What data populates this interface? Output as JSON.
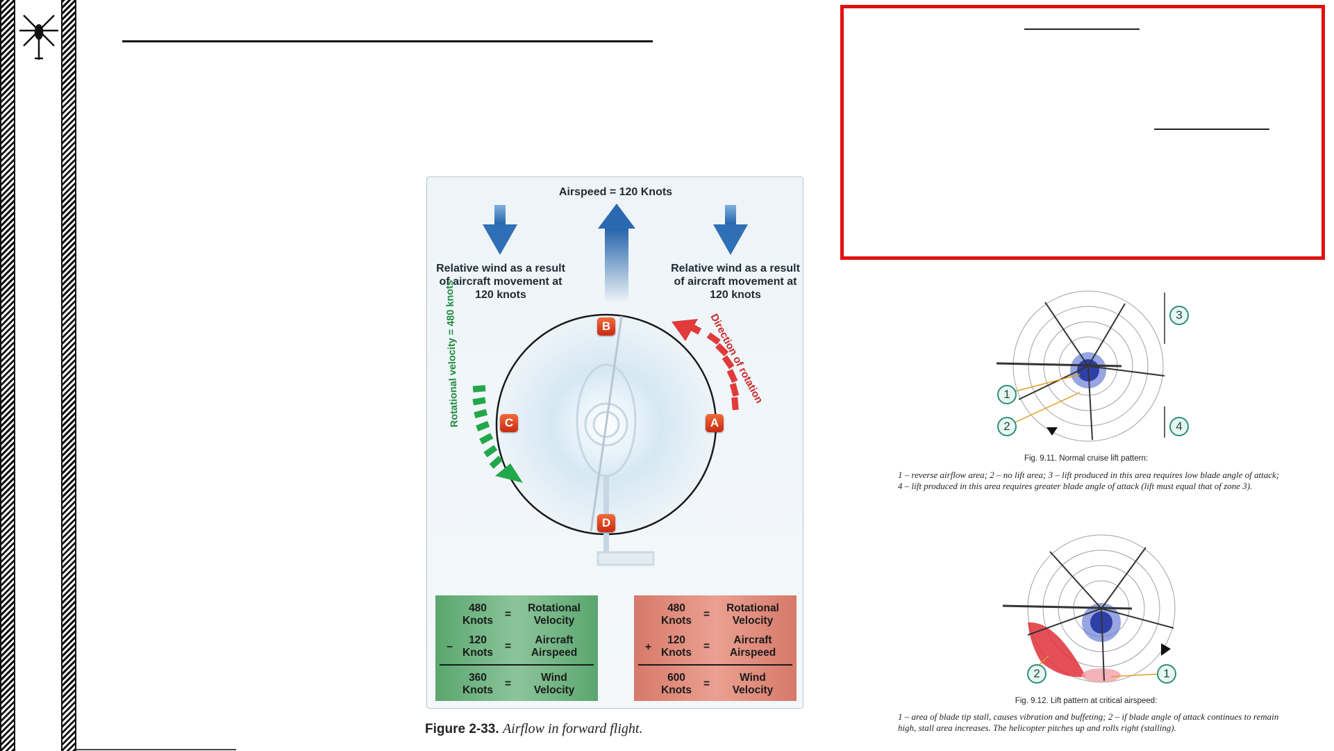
{
  "figure_main": {
    "airspeed_label": "Airspeed = 120 Knots",
    "relative_wind_left": "Relative wind as a result of aircraft movement at 120 knots",
    "relative_wind_right": "Relative wind as a result of aircraft movement at 120 knots",
    "direction_label": "Direction of rotation",
    "rotational_label": "Rotational velocity = 480 knots",
    "points": [
      "A",
      "B",
      "C",
      "D"
    ],
    "retreating_box": {
      "r1_knots": "480",
      "r1_unit": "Knots",
      "r1_label_1": "Rotational",
      "r1_label_2": "Velocity",
      "r2_op": "−",
      "r2_knots": "120",
      "r2_unit": "Knots",
      "r2_label_1": "Aircraft",
      "r2_label_2": "Airspeed",
      "r3_knots": "360",
      "r3_unit": "Knots",
      "r3_label_1": "Wind",
      "r3_label_2": "Velocity",
      "eq": "="
    },
    "advancing_box": {
      "r1_knots": "480",
      "r1_unit": "Knots",
      "r1_label_1": "Rotational",
      "r1_label_2": "Velocity",
      "r2_op": "+",
      "r2_knots": "120",
      "r2_unit": "Knots",
      "r2_label_1": "Aircraft",
      "r2_label_2": "Airspeed",
      "r3_knots": "600",
      "r3_unit": "Knots",
      "r3_label_1": "Wind",
      "r3_label_2": "Velocity",
      "eq": "="
    },
    "caption_bold": "Figure 2-33.",
    "caption_italic": "Airflow in forward flight."
  },
  "figure_911": {
    "markers": [
      "3",
      "1",
      "2",
      "4"
    ],
    "caption": "Fig. 9.11. Normal cruise lift pattern:",
    "description": "1 – reverse airflow area; 2 – no lift area; 3 – lift produced in this area requires low blade angle of attack; 4 – lift produced in this area requires greater blade angle of attack (lift must equal that of zone 3)."
  },
  "figure_912": {
    "markers": [
      "2",
      "1"
    ],
    "caption": "Fig. 9.12. Lift pattern at critical airspeed:",
    "description": "1 – area of blade tip stall, causes vibration and buffeting; 2 – if blade angle of attack continues to remain high, stall area increases. The helicopter pitches up and rolls right (stalling)."
  },
  "icons": {
    "logo": "helicopter-icon"
  },
  "colors": {
    "highlight_border": "#e01010",
    "advancing_arrow": "#e03030",
    "retreating_arrow": "#22a84a",
    "wind_arrow": "#2f78c0",
    "badge": "#e04a1f"
  }
}
